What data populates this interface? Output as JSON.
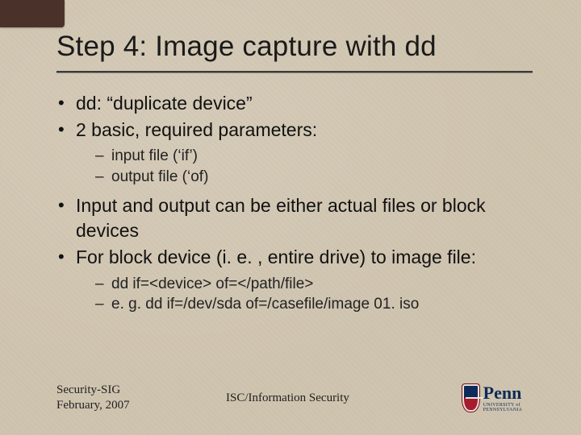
{
  "title": "Step 4: Image capture with dd",
  "bullets": [
    {
      "text": "dd: “duplicate device”"
    },
    {
      "text": "2 basic, required parameters:",
      "sub": [
        "input file (‘if’)",
        "output file (‘of)"
      ]
    },
    {
      "text": "Input and output can be either actual files or block devices"
    },
    {
      "text": "For block device (i. e. , entire drive) to image file:",
      "sub": [
        "dd if=<device> of=</path/file>",
        "e. g. dd if=/dev/sda of=/casefile/image 01. iso"
      ]
    }
  ],
  "footer": {
    "left_line1": "Security-SIG",
    "left_line2": "February, 2007",
    "center": "ISC/Information Security",
    "logo_text": "Penn",
    "logo_sub": "UNIVERSITY of PENNSYLVANIA"
  }
}
